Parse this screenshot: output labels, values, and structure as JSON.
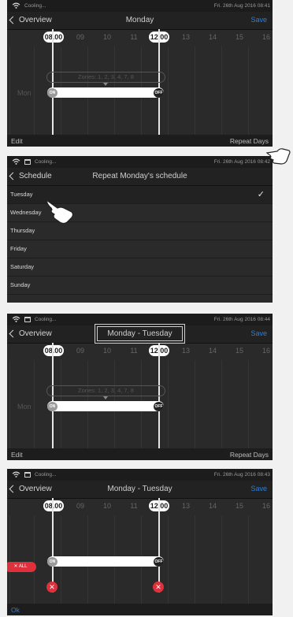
{
  "panel1": {
    "status": {
      "mode": "Cooling...",
      "datetime": "Fri. 26th Aug 2016 08:41"
    },
    "nav": {
      "back": "Overview",
      "title": "Monday",
      "save": "Save"
    },
    "ticks": [
      "08.00",
      "09",
      "10",
      "11",
      "12.00",
      "13",
      "14",
      "15",
      "16"
    ],
    "zones": "Zones: 1, 2, 3, 4, 7, 8",
    "day": "Mon",
    "on_label": "ON",
    "off_label": "OFF",
    "bottom": {
      "left": "Edit",
      "right": "Repeat Days"
    }
  },
  "panel2": {
    "status": {
      "mode": "Cooling...",
      "datetime": "Fri. 26th Aug 2016 08:42"
    },
    "nav": {
      "back": "Schedule",
      "title": "Repeat Monday's schedule"
    },
    "days": [
      "Tuesday",
      "Wednesday",
      "Thursday",
      "Friday",
      "Saturday",
      "Sunday"
    ],
    "check": "✓"
  },
  "panel3": {
    "status": {
      "mode": "Cooling...",
      "datetime": "Fri. 26th Aug 2016 08:44"
    },
    "nav": {
      "back": "Overview",
      "title": "Monday - Tuesday",
      "save": "Save"
    },
    "ticks": [
      "08.00",
      "09",
      "10",
      "11",
      "12.00",
      "13",
      "14",
      "15",
      "16"
    ],
    "zones": "Zones: 1, 2, 3, 4, 7, 8",
    "day": "Mon",
    "on_label": "ON",
    "off_label": "OFF",
    "bottom": {
      "left": "Edit",
      "right": "Repeat Days"
    }
  },
  "panel4": {
    "status": {
      "mode": "Cooling...",
      "datetime": "Fri. 26th Aug 2016 08:43"
    },
    "nav": {
      "back": "Overview",
      "title": "Monday - Tuesday",
      "save": "Save"
    },
    "ticks": [
      "08.00",
      "09",
      "10",
      "11",
      "12.00",
      "13",
      "14",
      "15",
      "16"
    ],
    "delete_all": "✕  ALL",
    "x": "✕",
    "on_label": "ON",
    "off_label": "OFF",
    "bottom": {
      "left": "Ok"
    }
  },
  "colors": {
    "accent": "#2f7fd8",
    "delete": "#e0303b",
    "panel": "#2a2a2a"
  }
}
